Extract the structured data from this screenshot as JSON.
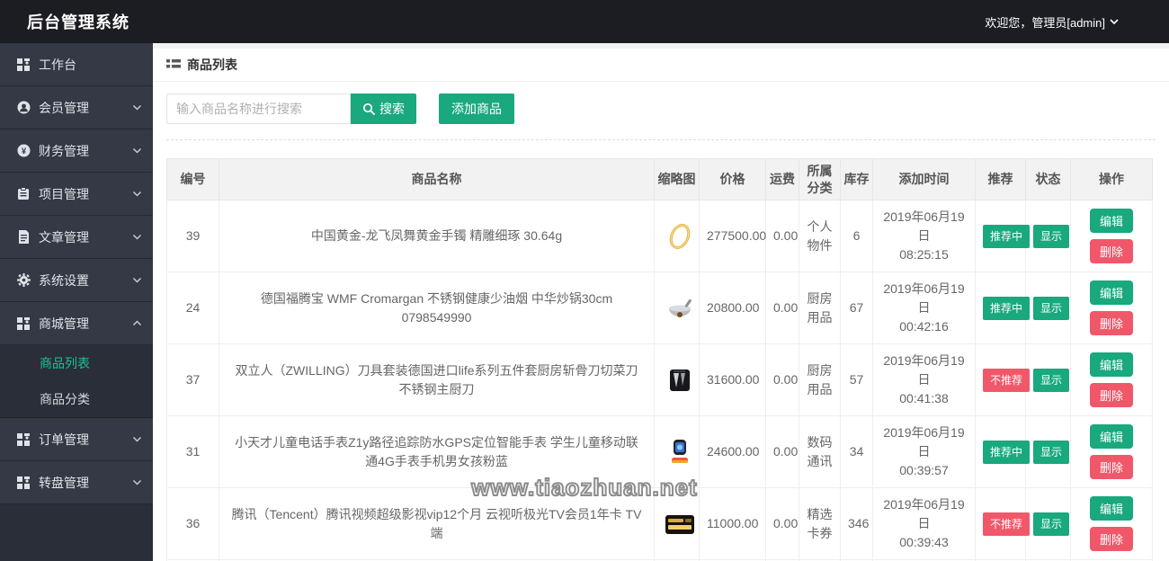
{
  "header": {
    "title": "后台管理系统",
    "welcome": "欢迎您，管理员[admin]"
  },
  "sidebar": {
    "items": [
      {
        "label": "工作台",
        "icon": "console-grid-icon",
        "expandable": false
      },
      {
        "label": "会员管理",
        "icon": "member-icon",
        "expandable": true
      },
      {
        "label": "财务管理",
        "icon": "finance-icon",
        "expandable": true
      },
      {
        "label": "项目管理",
        "icon": "project-icon",
        "expandable": true
      },
      {
        "label": "文章管理",
        "icon": "article-icon",
        "expandable": true
      },
      {
        "label": "系统设置",
        "icon": "gear-icon",
        "expandable": true
      },
      {
        "label": "商城管理",
        "icon": "mall-grid-icon",
        "expandable": true,
        "expanded": true,
        "children": [
          {
            "label": "商品列表",
            "active": true
          },
          {
            "label": "商品分类",
            "active": false
          }
        ]
      },
      {
        "label": "订单管理",
        "icon": "order-grid-icon",
        "expandable": true
      },
      {
        "label": "转盘管理",
        "icon": "wheel-grid-icon",
        "expandable": true
      }
    ]
  },
  "page": {
    "breadcrumb": "商品列表",
    "search_placeholder": "输入商品名称进行搜索",
    "search_button": "搜索",
    "add_button": "添加商品"
  },
  "table": {
    "headers": [
      "编号",
      "商品名称",
      "缩略图",
      "价格",
      "运费",
      "所属分类",
      "库存",
      "添加时间",
      "推荐",
      "状态",
      "操作"
    ],
    "action_labels": {
      "edit": "编辑",
      "delete": "删除"
    },
    "rows": [
      {
        "id": "39",
        "name": "中国黄金-龙飞凤舞黄金手镯 精雕细琢 30.64g",
        "thumb": "gold-bracelet",
        "price": "277500.00",
        "shipping": "0.00",
        "category": "个人物件",
        "stock": "6",
        "date": "2019年06月19日",
        "time": "08:25:15",
        "recommend": "推荐中",
        "recommend_state": "on",
        "status": "显示"
      },
      {
        "id": "24",
        "name": "德国福腾宝 WMF Cromargan 不锈钢健康少油烟 中华炒锅30cm 0798549990",
        "thumb": "wok",
        "price": "20800.00",
        "shipping": "0.00",
        "category": "厨房用品",
        "stock": "67",
        "date": "2019年06月19日",
        "time": "00:42:16",
        "recommend": "推荐中",
        "recommend_state": "on",
        "status": "显示"
      },
      {
        "id": "37",
        "name": "双立人（ZWILLING）刀具套装德国进口life系列五件套厨房斩骨刀切菜刀不锈钢主厨刀",
        "thumb": "knife-set",
        "price": "31600.00",
        "shipping": "0.00",
        "category": "厨房用品",
        "stock": "57",
        "date": "2019年06月19日",
        "time": "00:41:38",
        "recommend": "不推荐",
        "recommend_state": "off",
        "status": "显示"
      },
      {
        "id": "31",
        "name": "小天才儿童电话手表Z1y路径追踪防水GPS定位智能手表 学生儿童移动联通4G手表手机男女孩粉蓝",
        "thumb": "kids-watch",
        "price": "24600.00",
        "shipping": "0.00",
        "category": "数码通讯",
        "stock": "34",
        "date": "2019年06月19日",
        "time": "00:39:57",
        "recommend": "推荐中",
        "recommend_state": "on",
        "status": "显示"
      },
      {
        "id": "36",
        "name": "腾讯（Tencent）腾讯视频超级影视vip12个月 云视听极光TV会员1年卡 TV端",
        "thumb": "tv-card",
        "price": "11000.00",
        "shipping": "0.00",
        "category": "精选卡券",
        "stock": "346",
        "date": "2019年06月19日",
        "time": "00:39:43",
        "recommend": "不推荐",
        "recommend_state": "off",
        "status": "显示"
      }
    ]
  },
  "watermark": "www.tiaozhuan.net",
  "colors": {
    "accent_green": "#1aa87e",
    "danger_red": "#f0586a",
    "active_link_green": "#1dc195",
    "header_bg": "#1c1d23",
    "sidebar_bg": "#343945"
  }
}
